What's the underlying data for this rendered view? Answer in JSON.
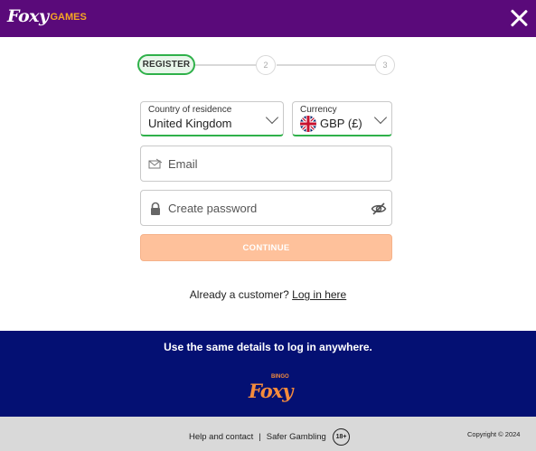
{
  "header": {
    "logo_main": "Foxy",
    "logo_sub": "GAMES",
    "close_icon": "close-icon"
  },
  "stepper": {
    "steps": [
      {
        "label": "REGISTER",
        "state": "active"
      },
      {
        "label": "2",
        "state": "pending"
      },
      {
        "label": "3",
        "state": "pending"
      }
    ]
  },
  "form": {
    "country": {
      "label": "Country of residence",
      "value": "United Kingdom"
    },
    "currency": {
      "label": "Currency",
      "value": "GBP (£)",
      "flag_icon": "uk-flag-icon"
    },
    "email": {
      "placeholder": "Email",
      "icon": "email-icon"
    },
    "password": {
      "placeholder": "Create password",
      "icon": "lock-icon",
      "toggle_icon": "eye-off-icon"
    },
    "continue_label": "CONTINUE"
  },
  "login_prompt": {
    "text": "Already a customer? ",
    "link": "Log in here"
  },
  "banner": {
    "text": "Use the same details to log in anywhere.",
    "logo_main": "Foxy",
    "logo_sub": "BINGO"
  },
  "footer": {
    "help_label": "Help and contact",
    "separator": "|",
    "safer_label": "Safer Gambling",
    "age_badge": "18+",
    "copyright": "Copyright © 2024"
  },
  "colors": {
    "header_bg": "#5a0a7a",
    "accent_green": "#2fb14a",
    "continue_bg": "#fec19b",
    "banner_bg": "#041073",
    "footer_bg": "#d9d9d9",
    "logo_orange": "#f5a623"
  }
}
